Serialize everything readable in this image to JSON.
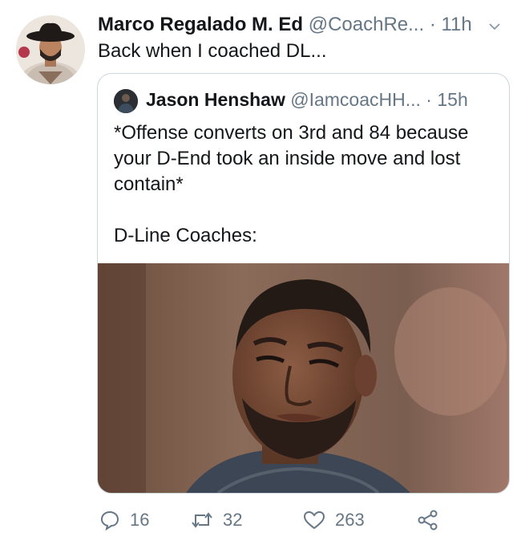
{
  "tweet": {
    "author": {
      "display_name": "Marco Regalado M. Ed",
      "handle": "@CoachRe...",
      "time": "11h",
      "avatar_icon": "cowboy-hat-man-avatar"
    },
    "separator": "·",
    "text": "Back when I coached DL...",
    "menu_icon": "chevron-down-icon"
  },
  "quoted_tweet": {
    "author": {
      "display_name": "Jason Henshaw",
      "handle": "@IamcoacHH...",
      "time": "15h",
      "avatar_icon": "user-avatar"
    },
    "paragraphs": [
      "*Offense converts on 3rd and 84 because your D-End took an inside move and lost contain*",
      "D-Line Coaches:"
    ],
    "image_icon": "sad-man-meme-photo"
  },
  "actions": {
    "reply_count": "16",
    "retweet_count": "32",
    "like_count": "263",
    "reply_icon": "comment-icon",
    "retweet_icon": "retweet-icon",
    "like_icon": "heart-icon",
    "share_icon": "share-icon"
  },
  "colors": {
    "text": "#14171a",
    "secondary": "#657786",
    "border": "#ccd6dd"
  }
}
